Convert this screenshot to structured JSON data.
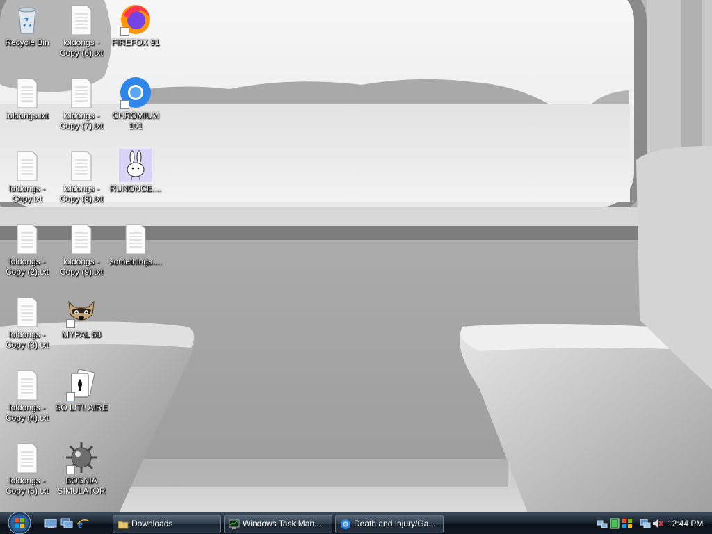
{
  "desktop": {
    "icons": [
      {
        "label": "Recycle Bin",
        "icon": "recycle-bin-icon"
      },
      {
        "label": "loldongs - Copy (6).txt",
        "icon": "text-file-icon"
      },
      {
        "label": "FIREFOX 91",
        "icon": "firefox-icon"
      },
      {
        "label": "loldongs.txt",
        "icon": "text-file-icon"
      },
      {
        "label": "loldongs - Copy (7).txt",
        "icon": "text-file-icon"
      },
      {
        "label": "CHROMIUM 101",
        "icon": "chromium-icon"
      },
      {
        "label": "loldongs - Copy.txt",
        "icon": "text-file-icon"
      },
      {
        "label": "loldongs - Copy (8).txt",
        "icon": "text-file-icon"
      },
      {
        "label": "RUNONCE....",
        "icon": "bunny-icon"
      },
      {
        "label": "loldongs - Copy (2).txt",
        "icon": "text-file-icon"
      },
      {
        "label": "loldongs - Copy (9).txt",
        "icon": "text-file-icon"
      },
      {
        "label": "somethings....",
        "icon": "text-file-icon"
      },
      {
        "label": "loldongs - Copy (3).txt",
        "icon": "text-file-icon"
      },
      {
        "label": "MYPAL 68",
        "icon": "raccoon-icon"
      },
      {
        "label": "loldongs - Copy (4).txt",
        "icon": "text-file-icon"
      },
      {
        "label": "SO LIT!! AIRE",
        "icon": "solitaire-card-icon"
      },
      {
        "label": "loldongs - Copy (5).txt",
        "icon": "text-file-icon"
      },
      {
        "label": "BOSNIA SIMULATOR",
        "icon": "mine-icon"
      }
    ]
  },
  "taskbar": {
    "start": {
      "icon": "windows-orb-icon"
    },
    "quick_launch": [
      {
        "icon": "show-desktop-icon"
      },
      {
        "icon": "switch-windows-icon"
      },
      {
        "icon": "internet-explorer-icon"
      }
    ],
    "buttons": [
      {
        "label": "Downloads",
        "icon": "folder-icon"
      },
      {
        "label": "Windows Task Man...",
        "icon": "task-manager-icon"
      },
      {
        "label": "Death and Injury/Ga...",
        "icon": "chromium-icon"
      }
    ],
    "tray": [
      {
        "icon": "network-tray-icon"
      },
      {
        "icon": "green-status-tray-icon"
      },
      {
        "icon": "windows-flag-tray-icon"
      },
      {
        "icon": "network-connection-icon"
      },
      {
        "icon": "volume-muted-icon"
      }
    ],
    "clock": "12:44 PM"
  },
  "colors": {
    "taskbar_bg": "#1d2733",
    "icon_label": "#ffffff"
  }
}
